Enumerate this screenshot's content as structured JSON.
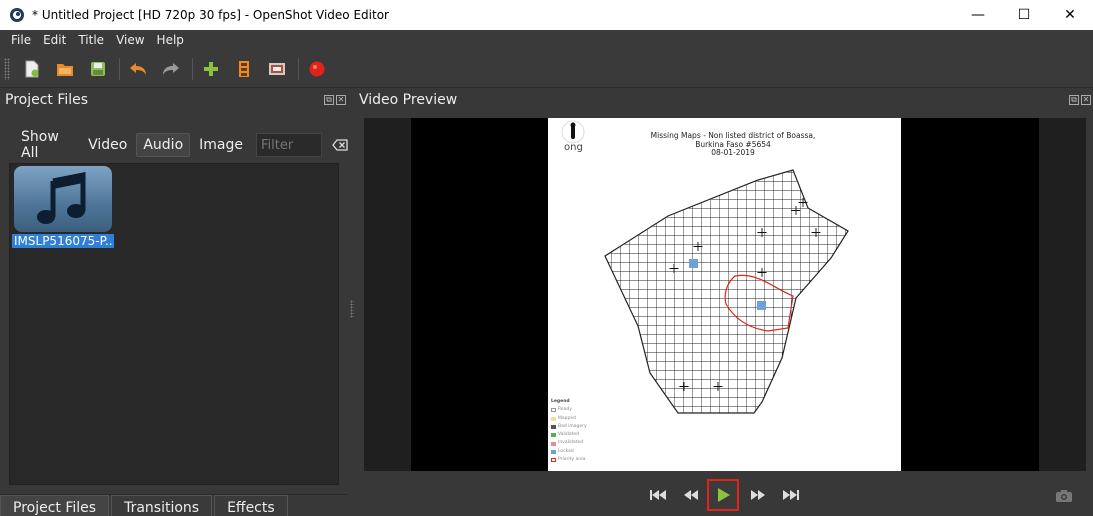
{
  "window": {
    "title": "* Untitled Project [HD 720p 30 fps] - OpenShot Video Editor",
    "controls": {
      "minimize": "—",
      "maximize": "☐",
      "close": "✕"
    }
  },
  "menu": {
    "items": [
      "File",
      "Edit",
      "Title",
      "View",
      "Help"
    ]
  },
  "toolbar": {
    "buttons": [
      "new-project-icon",
      "open-project-icon",
      "save-project-icon",
      "undo-icon",
      "redo-icon",
      "import-files-icon",
      "choose-profile-icon",
      "fullscreen-icon",
      "export-video-icon"
    ]
  },
  "project_files": {
    "title": "Project Files",
    "filters": {
      "show_all": "Show All",
      "video": "Video",
      "audio": "Audio",
      "image": "Image",
      "selected": "Audio"
    },
    "filter_placeholder": "Filter",
    "files": [
      {
        "name": "IMSLP516075-P..."
      }
    ]
  },
  "bottom_tabs": [
    "Project Files",
    "Transitions",
    "Effects"
  ],
  "video_preview": {
    "title": "Video Preview",
    "frame": {
      "title_line1": "Missing Maps - Non listed district of Boassa,",
      "title_line2": "Burkina Faso #5654",
      "title_line3": "08-01-2019",
      "legend_title": "Legend",
      "legend": [
        "Ready",
        "Mapped",
        "Bad imagery",
        "Validated",
        "Invalidated",
        "Locked",
        "Priority area"
      ],
      "legend_colors": [
        "#ffffff",
        "#f7dca0",
        "#555555",
        "#5aaa5a",
        "#e98a9a",
        "#6fa0d8",
        "#ffffff"
      ],
      "logo_text": "ong"
    }
  },
  "colors": {
    "accent": "#2f7fd8",
    "play_highlight": "#e2231a",
    "play_icon": "#8ac43f",
    "record": "#e2231a"
  }
}
